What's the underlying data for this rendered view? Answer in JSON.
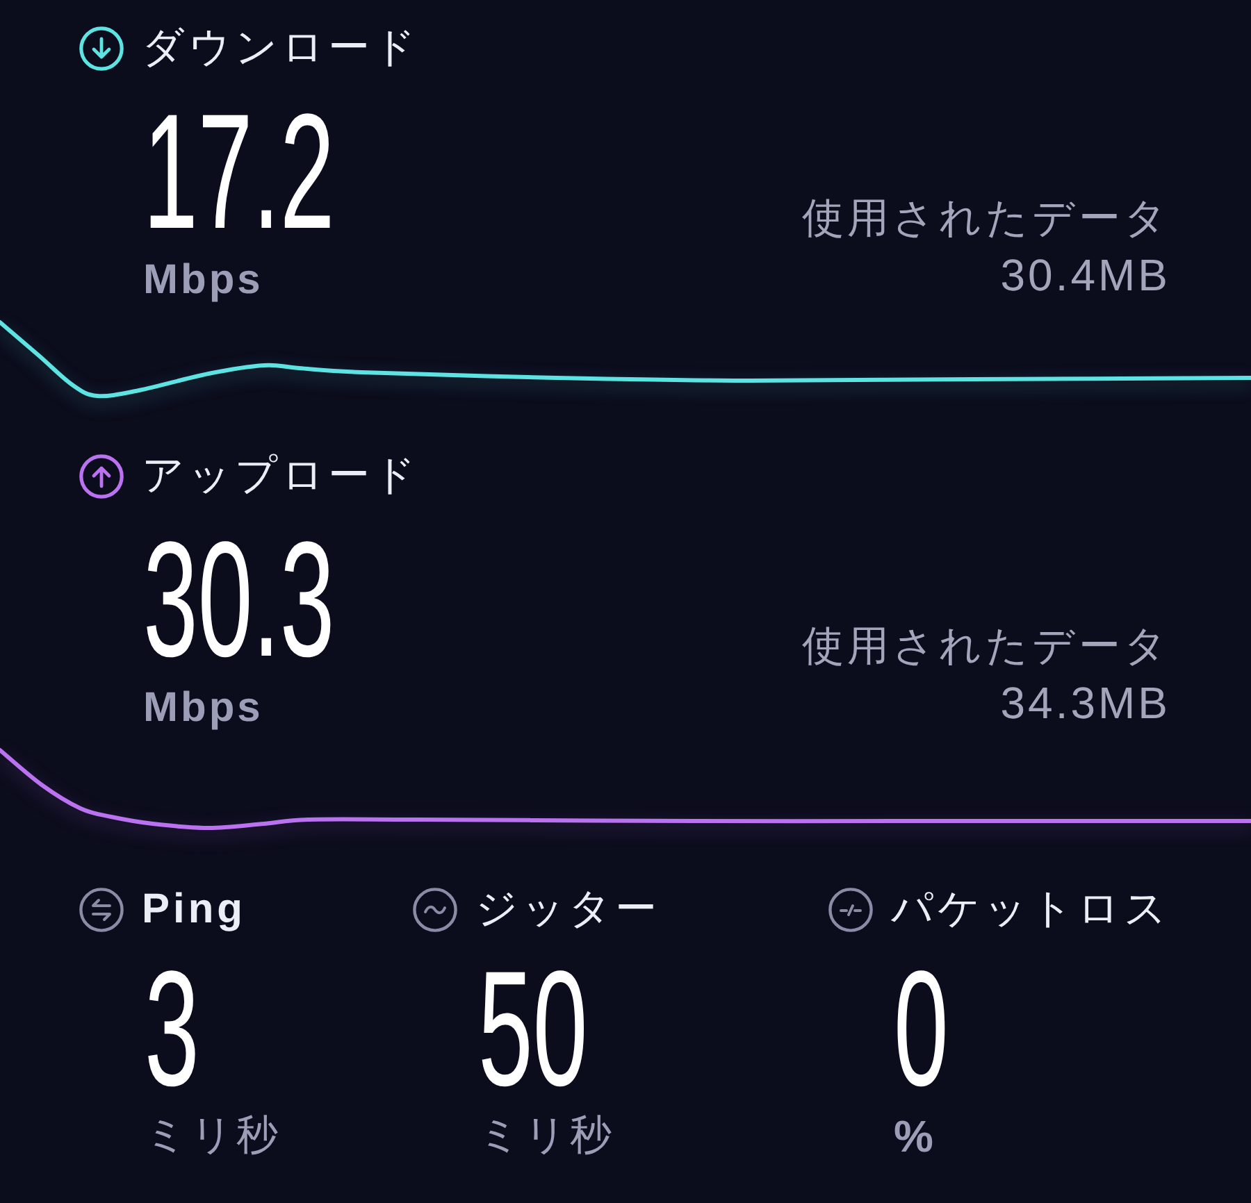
{
  "speeds": [
    {
      "kind": "download",
      "label": "ダウンロード",
      "value": "17.2",
      "unit": "Mbps",
      "data_label": "使用されたデータ",
      "data_value": "30.4MB",
      "color": "#5ee3e3"
    },
    {
      "kind": "upload",
      "label": "アップロード",
      "value": "30.3",
      "unit": "Mbps",
      "data_label": "使用されたデータ",
      "data_value": "34.3MB",
      "color": "#bb72f0"
    }
  ],
  "metrics": [
    {
      "kind": "ping",
      "label": "Ping",
      "value": "3",
      "unit": "ミリ秒"
    },
    {
      "kind": "jitter",
      "label": "ジッター",
      "value": "50",
      "unit": "ミリ秒"
    },
    {
      "kind": "packet_loss",
      "label": "パケットロス",
      "value": "0",
      "unit": "%"
    }
  ]
}
